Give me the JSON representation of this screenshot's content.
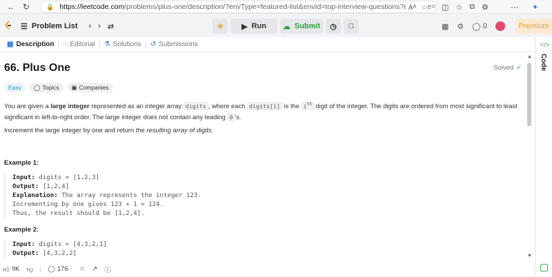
{
  "browser": {
    "url_domain": "https://leetcode.com",
    "url_path": "/problems/plus-one/description/?envType=featured-list&envId=top-interview-questions?envType=fe...",
    "read_aloud": "Aᴬ"
  },
  "nav": {
    "problem_list": "Problem List",
    "run": "Run",
    "submit": "Submit",
    "streak": "0",
    "premium": "Premium"
  },
  "tabs": [
    "Description",
    "Editorial",
    "Solutions",
    "Submissions"
  ],
  "problem": {
    "title": "66. Plus One",
    "status": "Solved",
    "badges": [
      "Easy",
      "Topics",
      "Companies"
    ],
    "p1_a": "You are given a ",
    "p1_b": "large integer",
    "p1_c": " represented as an integer array ",
    "p1_code1": "digits",
    "p1_d": ", where each ",
    "p1_code2": "digits[i]",
    "p1_e": " is the ",
    "p1_code3": "i",
    "p1_sup": "th",
    "p1_f": " digit of the integer. The digits are ordered from most significant to least significant in left-to-right order. The large integer does not contain any leading ",
    "p1_code4": "0",
    "p1_g": "'s.",
    "p2_a": "Increment the large integer by one and return ",
    "p2_b": "the resulting array of digits",
    "p2_c": "."
  },
  "examples": [
    {
      "title": "Example 1:",
      "input_label": "Input:",
      "input": "digits = [1,2,3]",
      "output_label": "Output:",
      "output": "[1,2,4]",
      "explanation_label": "Explanation:",
      "explanation": [
        "The array represents the integer 123.",
        "Incrementing by one gives 123 + 1 = 124.",
        "Thus, the result should be [1,2,4]."
      ]
    },
    {
      "title": "Example 2:",
      "input_label": "Input:",
      "input": "digits = [4,3,2,1]",
      "output_label": "Output:",
      "output": "[4,3,2,2]"
    }
  ],
  "footer": {
    "likes": "9K",
    "comments": "176"
  },
  "code_rail": {
    "label": "Code"
  }
}
